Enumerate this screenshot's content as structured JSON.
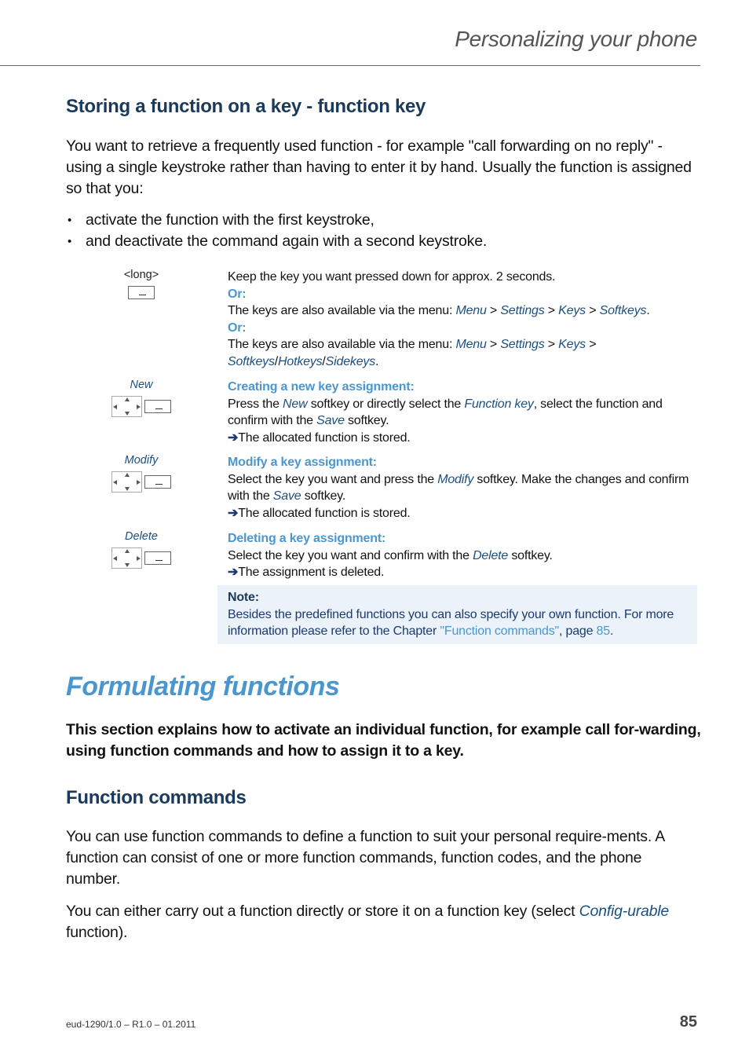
{
  "header": {
    "title": "Personalizing your phone"
  },
  "section1": {
    "heading": "Storing a function on a key - function key",
    "intro": "You want to retrieve  a frequently used function - for example \"call forwarding on no reply\" - using a single keystroke rather than having to enter it by hand. Usually the function is assigned so that you:",
    "bullets": [
      "activate the function with the first keystroke,",
      "and deactivate the command again with a second keystroke."
    ]
  },
  "steps": {
    "long": {
      "label": "<long>",
      "line1": "Keep the key you want pressed down for approx. 2 seconds.",
      "or1": "Or:",
      "menu1_prefix": "The keys are also available via the menu: ",
      "menu1": [
        "Menu",
        "Settings",
        "Keys",
        "Softkeys"
      ],
      "or2": "Or:",
      "menu2_prefix": "The keys are also available via the menu: ",
      "menu2": [
        "Menu",
        "Settings",
        "Keys"
      ],
      "menu2_last": [
        "Softkeys",
        "Hotkeys",
        "Sidekeys"
      ],
      "sep": " > ",
      "slash": "/",
      "period": "."
    },
    "new": {
      "label": "New",
      "heading": "Creating a new key assignment:",
      "t1": "Press the ",
      "l1": "New",
      "t2": " softkey or directly select the ",
      "l2": "Function key",
      "t3": ", select the function and confirm with the ",
      "l3": "Save",
      "t4": " softkey.",
      "result": "The allocated function is stored."
    },
    "modify": {
      "label": "Modify",
      "heading": "Modify a key assignment:",
      "t1": "Select the key you want and press the ",
      "l1": "Modify",
      "t2": " softkey. Make the changes and confirm with the ",
      "l2": "Save",
      "t3": " softkey.",
      "result": "The allocated function is stored."
    },
    "delete": {
      "label": "Delete",
      "heading": "Deleting a key assignment:",
      "t1": "Select the key you want and confirm with the ",
      "l1": "Delete",
      "t2": " softkey.",
      "result": "The assignment is deleted."
    },
    "arrow": "➔"
  },
  "note": {
    "heading": "Note:",
    "text": "Besides the predefined functions you can also specify your own function. For more information please refer to the Chapter ",
    "link": "\"Function commands\"",
    "mid": ", page ",
    "page": "85",
    "end": "."
  },
  "section2": {
    "title": "Formulating functions",
    "lead": "This section explains how to activate an individual function, for example call for-warding, using function commands and how to assign it to a key.",
    "subheading": "Function commands",
    "p1": "You can use function commands to define a function to suit your personal require-ments. A function can consist of one or more function commands, function codes, and the phone number.",
    "p2_start": "You can either carry out a function directly or store it on a function key (select ",
    "p2_link": "Config-urable",
    "p2_end": " function)."
  },
  "footer": {
    "doc_id": "eud-1290/1.0 – R1.0 – 01.2011",
    "page": "85"
  }
}
